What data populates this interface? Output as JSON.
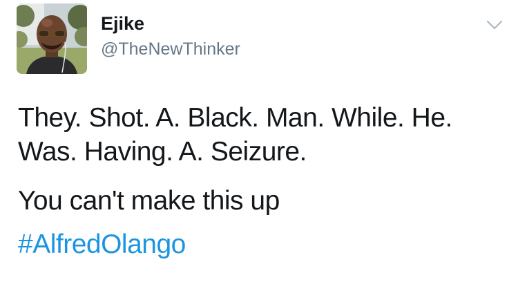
{
  "tweet": {
    "author": {
      "name": "Ejike",
      "handle": "@TheNewThinker"
    },
    "text_lines": [
      "They. Shot. A. Black. Man. While. He.",
      "Was. Having. A. Seizure.",
      "You can't make this up"
    ],
    "hashtag": "#AlfredOlango",
    "icons": {
      "menu": "chevron-down-icon"
    },
    "colors": {
      "text": "#14171a",
      "secondary": "#657786",
      "link": "#1b95e0",
      "caret": "#aab8c2"
    }
  }
}
